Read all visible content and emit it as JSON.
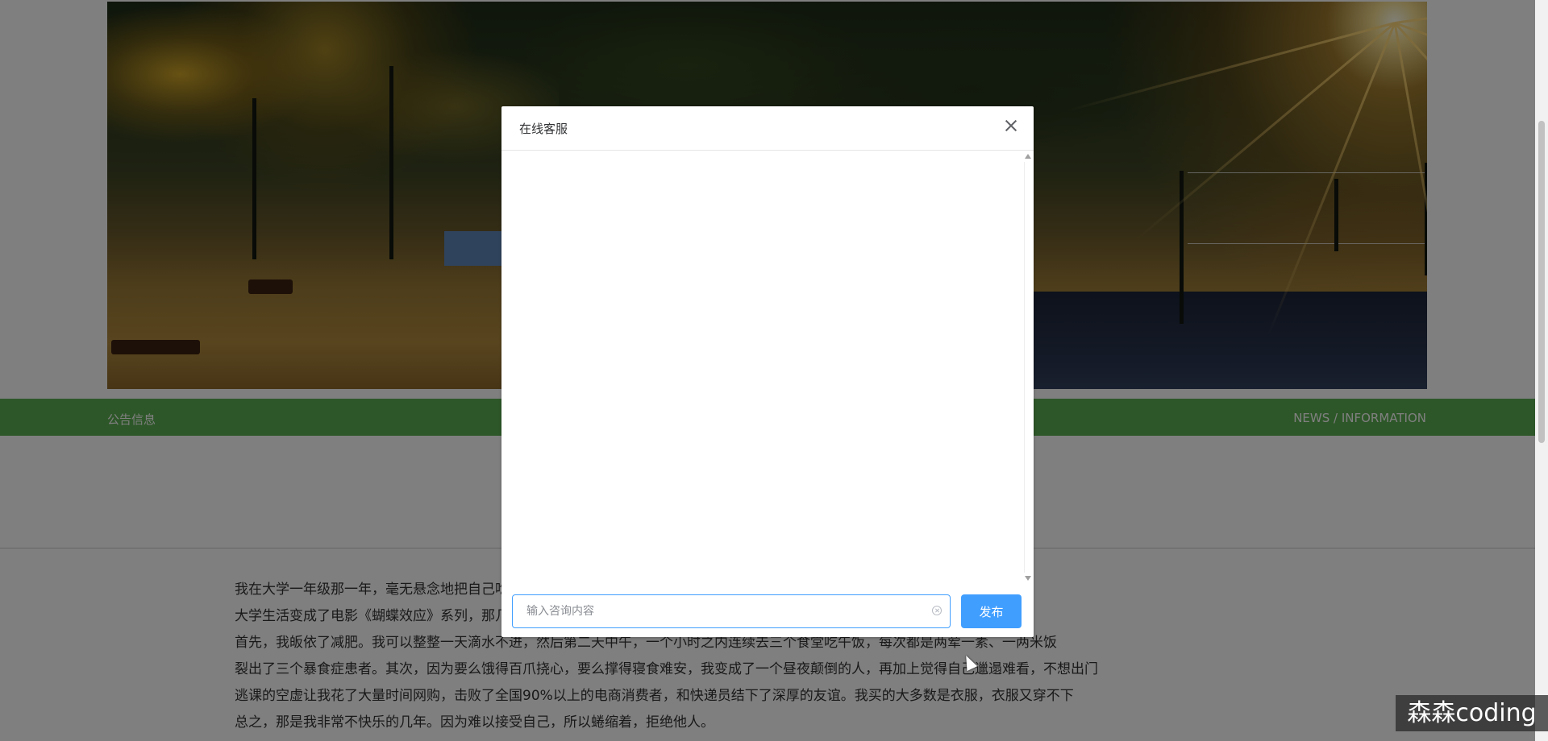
{
  "section_bar": {
    "title": "公告信息",
    "subtitle": "NEWS / INFORMATION"
  },
  "article": {
    "lines": [
      "我在大学一年级那一年，毫无悬念地把自己吃成了一个胖子，比标准体型重了15斤。于是，我的整个",
      "大学生活变成了电影《蝴蝶效应》系列，那几年里发生的一切，几乎都和体重有关。",
      "首先，我皈依了减肥。我可以整整一天滴水不进，然后第二天中午，一个小时之内连续去三个食堂吃午饭，每次都是两荤一素、一两米饭",
      "裂出了三个暴食症患者。其次，因为要么饿得百爪挠心，要么撑得寝食难安，我变成了一个昼夜颠倒的人，再加上觉得自己邋遢难看，不想出门",
      "逃课的空虚让我花了大量时间网购，击败了全国90%以上的电商消费者，和快递员结下了深厚的友谊。我买的大多数是衣服，衣服又穿不下",
      "总之，那是我非常不快乐的几年。因为难以接受自己，所以蜷缩着，拒绝他人。"
    ]
  },
  "dialog": {
    "title": "在线客服",
    "input_placeholder": "输入咨询内容",
    "input_value": "",
    "publish_label": "发布"
  },
  "watermark": {
    "text": "森森coding"
  },
  "colors": {
    "green_bar": "#5aae51",
    "primary": "#409eff",
    "overlay": "rgba(0,0,0,0.5)"
  },
  "icons": {
    "close": "close-icon",
    "clear": "circle-close-icon"
  }
}
